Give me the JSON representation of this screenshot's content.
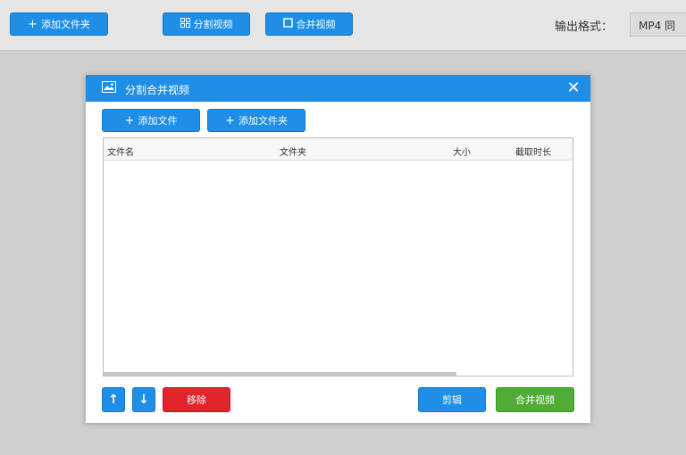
{
  "toolbar": {
    "add_folder": "添加文件夹",
    "split_video": "分割视频",
    "merge_video": "合并视频",
    "output_format_label": "输出格式：",
    "output_format_value": "MP4 同"
  },
  "dialog": {
    "title": "分割合并视频",
    "close": "✕",
    "add_file": "添加文件",
    "add_folder": "添加文件夹",
    "columns": [
      "文件名",
      "文件夹",
      "大小",
      "截取时长"
    ],
    "remove": "移除",
    "edit": "剪辑",
    "merge": "合并视频",
    "move_up": "↑",
    "move_down": "↓"
  },
  "colors": {
    "accent": "#1e8ee6",
    "danger": "#e0252b",
    "success": "#4fad35"
  }
}
